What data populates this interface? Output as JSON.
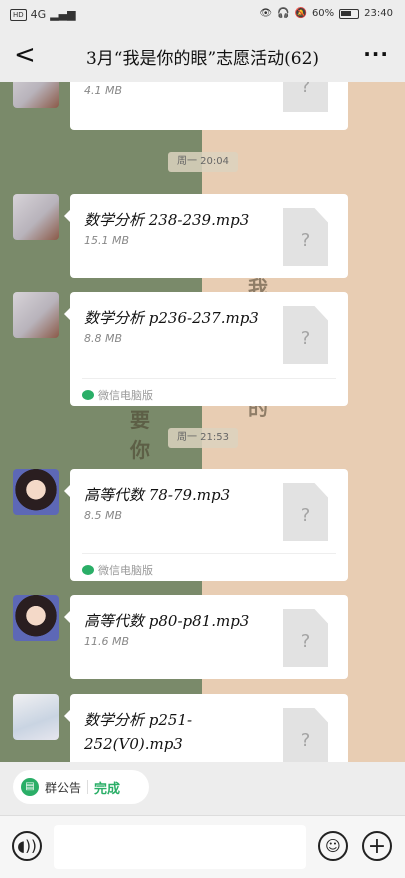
{
  "status": {
    "badge": "HD",
    "signal": "4G",
    "battery": "60%",
    "time": "23:40"
  },
  "header": {
    "back": "<",
    "title": "3月“我是你的眼”志愿活动(62)",
    "more": "···"
  },
  "background_text": [
    "要",
    "你",
    "我",
    "的"
  ],
  "messages": [
    {
      "filename": "",
      "size": "4.1 MB",
      "footer": ""
    },
    {
      "filename": "数学分析 238-239.mp3",
      "size": "15.1 MB",
      "footer": ""
    },
    {
      "filename": "数学分析 p236-237.mp3",
      "size": "8.8 MB",
      "footer": "微信电脑版"
    },
    {
      "filename": "高等代数 78-79.mp3",
      "size": "8.5 MB",
      "footer": "微信电脑版"
    },
    {
      "filename": "高等代数 p80-p81.mp3",
      "size": "11.6 MB",
      "footer": ""
    },
    {
      "filename": "数学分析 p251-252(V0).mp3",
      "size": "",
      "footer": ""
    }
  ],
  "times": [
    "周一 20:04",
    "周一 21:53"
  ],
  "file_icon_glyph": "?",
  "announcement": {
    "label": "群公告",
    "done": "完成"
  },
  "input": {
    "voice_icon": "voice-icon",
    "emoji_icon": "emoji-icon",
    "plus_icon": "plus-icon"
  }
}
